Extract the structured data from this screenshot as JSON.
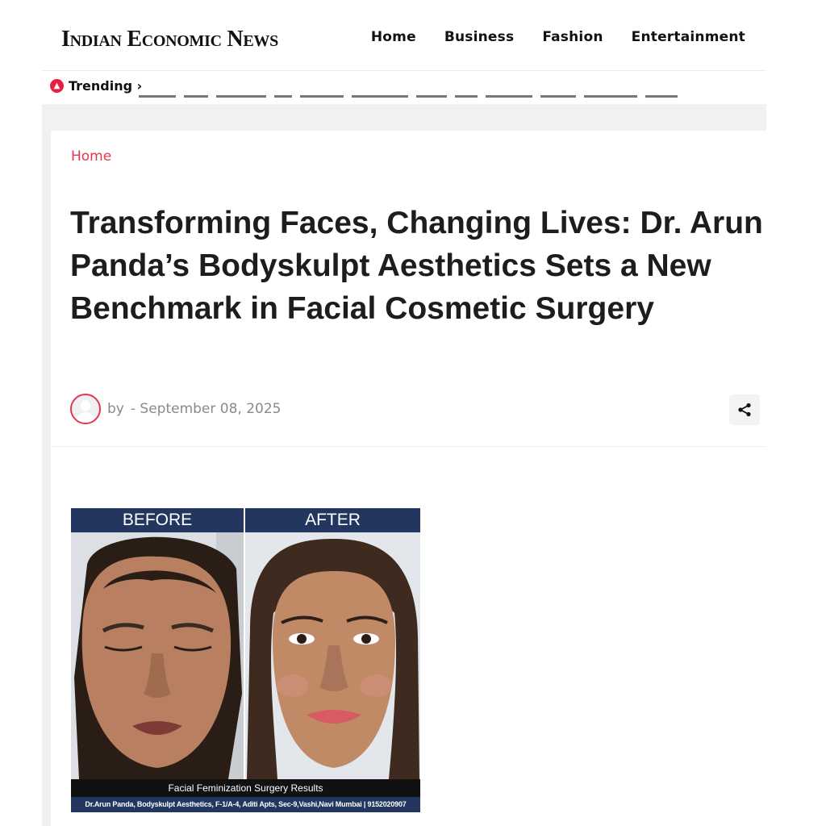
{
  "site": {
    "logo": "Indian Economic News"
  },
  "nav": {
    "items": [
      "Home",
      "Business",
      "Fashion",
      "Entertainment"
    ]
  },
  "trending": {
    "label": "Trending ›"
  },
  "breadcrumb": {
    "home": "Home"
  },
  "article": {
    "title": "Transforming Faces, Changing Lives: Dr. Arun Panda’s Bodyskulpt Aesthetics Sets a New Benchmark in Facial Cosmetic Surgery",
    "by": "by",
    "date": "- September 08, 2025"
  },
  "image": {
    "before_label": "BEFORE",
    "after_label": "AFTER",
    "caption": "Facial Feminization Surgery Results",
    "footer": "Dr.Arun Panda, Bodyskulpt Aesthetics, F-1/A-4, Aditi Apts, Sec-9,Vashi,Navi Mumbai | 9152020907"
  },
  "icons": {
    "trending": "trending-dot-icon",
    "share": "share-icon",
    "avatar": "user-avatar-icon"
  },
  "colors": {
    "accent": "#e8334d",
    "navy": "#22365f",
    "text": "#1d1d1d"
  }
}
